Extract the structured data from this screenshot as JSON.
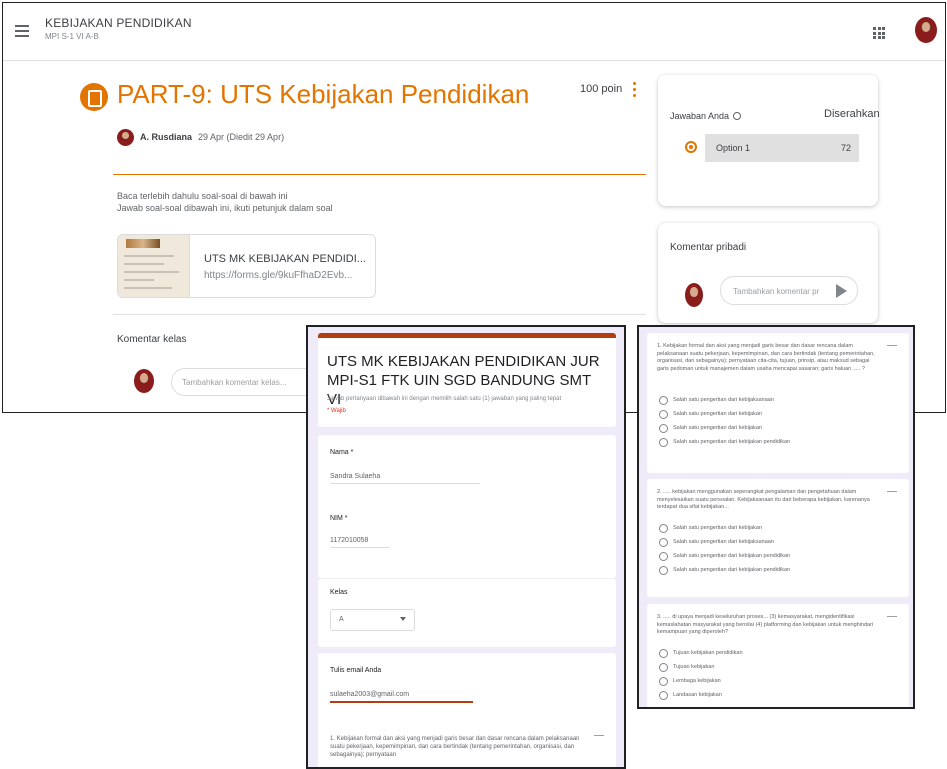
{
  "classroom": {
    "course_title": "KEBIJAKAN PENDIDIKAN",
    "course_subtitle": "MPI S-1 VI A-B",
    "assignment_title": "PART-9: UTS Kebijakan Pendidikan",
    "points": "100 poin",
    "author": "A. Rusdiana",
    "date": "29 Apr (Diedit 29 Apr)",
    "description_line1": "Baca terlebih dahulu soal-soal di bawah ini",
    "description_line2": "Jawab soal-soal dibawah ini, ikuti petunjuk dalam soal",
    "attachment_title": "UTS MK KEBIJAKAN PENDIDI...",
    "attachment_url": "https://forms.gle/9kuFfhaD2Evb...",
    "class_comments_label": "Komentar kelas",
    "class_comment_placeholder": "Tambahkan komentar kelas...",
    "your_work_label": "Jawaban Anda",
    "work_status": "Diserahkan",
    "selected_option": "Option 1",
    "selected_option_count": "72",
    "private_comments_label": "Komentar pribadi",
    "private_comment_placeholder": "Tambahkan komentar pr"
  },
  "form1": {
    "title": "UTS MK KEBIJAKAN PENDIDIKAN JUR MPI-S1 FTK UIN SGD BANDUNG SMT VI",
    "description": "Jawab pertanyaan dibawah ini dengan memilih salah satu (1) jawaban yang paling tepat",
    "required_note": "* Wajib",
    "name_label": "Nama *",
    "name_value": "Sandra Sulaeha",
    "nim_label": "NIM *",
    "nim_value": "1172010058",
    "class_label": "Kelas",
    "class_value": "A",
    "email_label": "Tulis email Anda",
    "email_value": "sulaeha2003@gmail.com",
    "question_preview": "1. Kebijakan formal dan aksi yang menjadi garis besar dan dasar rencana dalam pelaksanaan suatu pekerjaan, kepemimpinan, dan cara bertindak (tentang pemerintahan, organisasi, dan sebagainya); pernyataan"
  },
  "form2": {
    "questions": [
      {
        "text": "1. Kebijakan formal dan aksi yang menjadi garis besar dan dasar rencana dalam pelaksanaan suatu pekerjaan, kepemimpinan, dan cara bertindak (tentang pemerintahan, organisasi, dan sebagainya); pernyataan cita-cita, tujuan, prinsip, atau maksud sebagai garis pedoman untuk manajemen dalam usaha mencapai sasaran; garis haluan ..... ?",
        "options": [
          "Salah satu pengertian dari kebijaksanaan",
          "Salah satu pengertian dari kebijakan",
          "Salah satu pengertian dari kebijakan",
          "Salah satu pengertian dari kebijakan pendidikan"
        ]
      },
      {
        "text": "2. ..... kebijakan menggunakan seperangkat pengalaman dan pengetahuan dalam menyelesaikan suatu persoalan. Kebijaksanaan itu dari beberapa kebijakan, karenanya terdapat dua sifat kebijakan...",
        "options": [
          "Salah satu pengertian dari kebijakan",
          "Salah satu pengertian dari kebijaksanaan",
          "Salah satu pengertian dari kebijakan pendidikan",
          "Salah satu pengertian dari kebijakan pendidikan"
        ]
      },
      {
        "text": "3. ..... di upaya menjadi keseluruhan proses... (3) kemasyarakat, mengidentifikasi kemaslahatan masyarakat yang bernilai (4) platforming dan kebijakan untuk menghindari kemampuan yang diperoleh?",
        "options": [
          "Tujuan kebijakan pendidikan",
          "Tujuan kebijakan",
          "Lembaga kebijakan",
          "Landasan kebijakan"
        ]
      }
    ]
  }
}
